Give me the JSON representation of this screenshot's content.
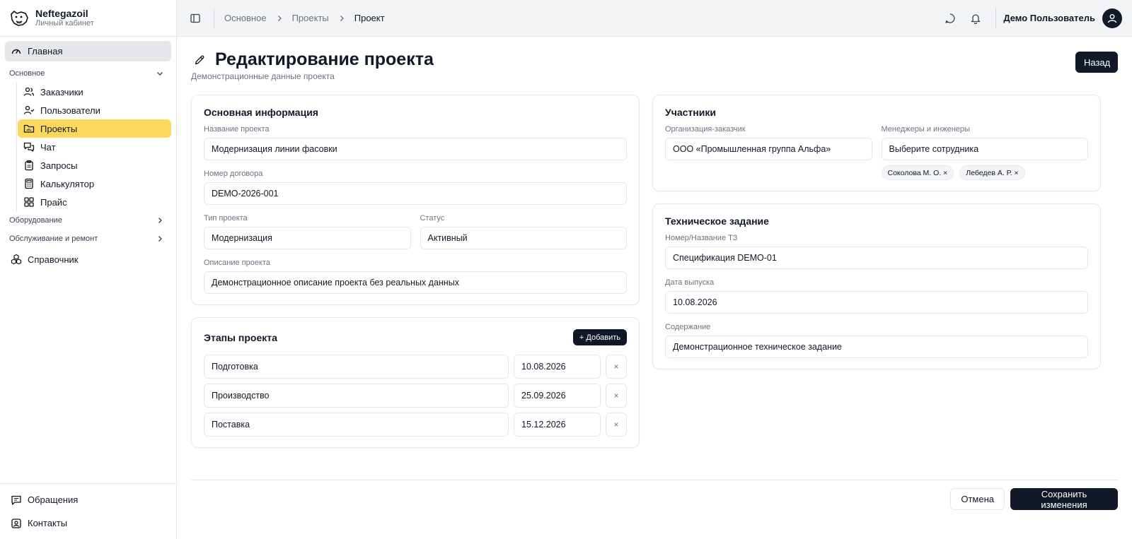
{
  "brand": {
    "name": "Neftegazoil",
    "subtitle": "Личный кабинет"
  },
  "sidebar": {
    "home": "Главная",
    "group_main": "Основное",
    "main_items": [
      "Заказчики",
      "Пользователи",
      "Проекты",
      "Чат",
      "Запросы",
      "Калькулятор",
      "Прайс"
    ],
    "group_equipment": "Оборудование",
    "group_service": "Обслуживание и ремонт",
    "reference": "Справочник",
    "bottom_items": [
      "Обращения",
      "Контакты"
    ],
    "active_color": "#fcd95c"
  },
  "topbar": {
    "breadcrumb": [
      "Основное",
      "Проекты",
      "Проект"
    ],
    "user_name": "Демо Пользователь"
  },
  "page": {
    "title": "Редактирование проекта",
    "subtitle": "Демонстрационные данные проекта",
    "back_label": "Назад"
  },
  "basic": {
    "title": "Основная информация",
    "name_label": "Название проекта",
    "name_value": "Модернизация линии фасовки",
    "contract_label": "Номер договора",
    "contract_value": "DEMO-2026-001",
    "type_label": "Тип проекта",
    "type_value": "Модернизация",
    "status_label": "Статус",
    "status_value": "Активный",
    "desc_label": "Описание проекта",
    "desc_value": "Демонстрационное описание проекта без реальных данных"
  },
  "stages": {
    "title": "Этапы проекта",
    "add_label": "+ Добавить",
    "delete_glyph": "×",
    "rows": [
      {
        "name": "Подготовка",
        "date": "10.08.2026"
      },
      {
        "name": "Производство",
        "date": "25.09.2026"
      },
      {
        "name": "Поставка",
        "date": "15.12.2026"
      }
    ]
  },
  "participants": {
    "title": "Участники",
    "org_label": "Организация-заказчик",
    "org_value": "ООО «Промышленная группа Альфа»",
    "managers_label": "Менеджеры и инженеры",
    "managers_placeholder": "Выберите сотрудника",
    "chips": [
      "Соколова М. О. ×",
      "Лебедев А. Р. ×"
    ]
  },
  "tz": {
    "title": "Техническое задание",
    "number_label": "Номер/Название ТЗ",
    "number_value": "Спецификация DEMO-01",
    "date_label": "Дата выпуска",
    "date_value": "10.08.2026",
    "content_label": "Содержание",
    "content_value": "Демонстрационное техническое задание"
  },
  "footer": {
    "cancel_label": "Отмена",
    "save_label": "Сохранить изменения"
  }
}
